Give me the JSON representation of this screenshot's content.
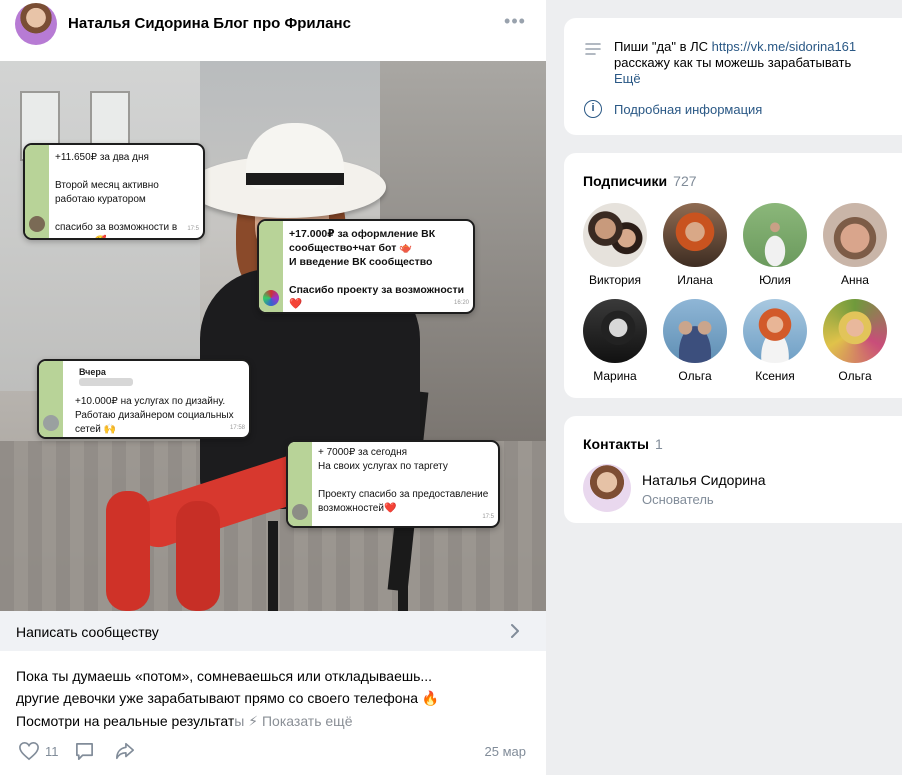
{
  "post": {
    "author": "Наталья Сидорина  Блог про Фриланс",
    "more_icon": "more-horizontal-icon",
    "chats": [
      {
        "lines": "+11.650₽ за два дня\n\nВторой месяц активно работаю куратором\n\nспасибо за возможности в декрете 🥰",
        "time": "17:5"
      },
      {
        "lines": "+17.000₽ за оформление ВК сообщество+чат бот 🫖\nИ введение ВК сообщество\n\nСпасибо проекту за возможности\n❤️",
        "time": "16:20"
      },
      {
        "sender": "Вчера",
        "lines": "+10.000₽ на услугах по дизайну. Работаю дизайнером социальных сетей 🙌",
        "time": "17:58"
      },
      {
        "lines": "+ 7000₽ за сегодня\nНа своих услугах по таргету\n\nПроекту спасибо за предоставление возможностей❤️",
        "time": "17:5"
      }
    ],
    "write_label": "Написать сообществу",
    "text_line1": "Пока ты думаешь «потом», сомневаешься или откладываешь...",
    "text_line2": "другие девочки уже зарабатывают прямо со своего телефона 🔥",
    "text_line3_a": "Посмотри на реальные результат",
    "text_line3_b": "ы ⚡",
    "show_more": "Показать ещё",
    "likes": "11",
    "date": "25 мар"
  },
  "info": {
    "text_prefix": "Пиши \"да\" в ЛС ",
    "link": "https://vk.me/sidorina161",
    "text_suffix": "расскажу как ты можешь зарабатывать",
    "more": "Ещё",
    "detail": "Подробная информация"
  },
  "subscribers": {
    "title": "Подписчики",
    "count": "727",
    "people": [
      {
        "name": "Виктория"
      },
      {
        "name": "Илана"
      },
      {
        "name": "Юлия"
      },
      {
        "name": "Анна"
      },
      {
        "name": "Марина"
      },
      {
        "name": "Ольга"
      },
      {
        "name": "Ксения"
      },
      {
        "name": "Ольга"
      }
    ]
  },
  "contacts": {
    "title": "Контакты",
    "count": "1",
    "name": "Наталья Сидорина",
    "role": "Основатель"
  },
  "colors": {
    "link": "#2a5885",
    "muted": "#818c99",
    "page_bg": "#edeef0",
    "chat_strip": "#b8d398"
  }
}
